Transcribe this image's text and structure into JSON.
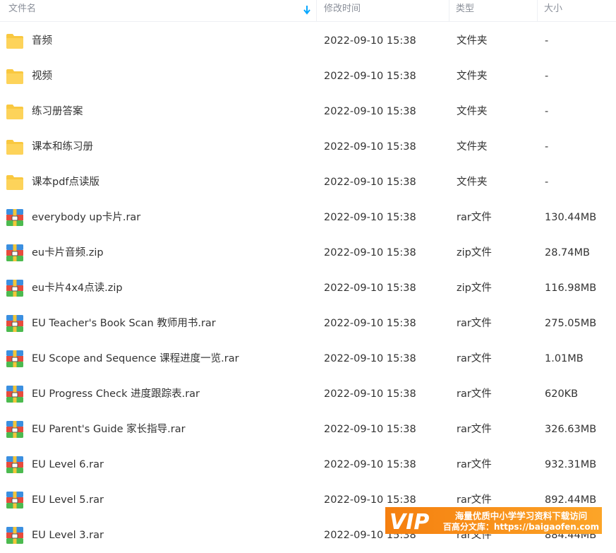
{
  "header": {
    "name_label": "文件名",
    "date_label": "修改时间",
    "type_label": "类型",
    "size_label": "大小"
  },
  "files": [
    {
      "name": "音频",
      "date": "2022-09-10 15:38",
      "type": "文件夹",
      "size": "-",
      "icon": "folder-icon"
    },
    {
      "name": "视频",
      "date": "2022-09-10 15:38",
      "type": "文件夹",
      "size": "-",
      "icon": "folder-icon"
    },
    {
      "name": "练习册答案",
      "date": "2022-09-10 15:38",
      "type": "文件夹",
      "size": "-",
      "icon": "folder-icon"
    },
    {
      "name": "课本和练习册",
      "date": "2022-09-10 15:38",
      "type": "文件夹",
      "size": "-",
      "icon": "folder-icon"
    },
    {
      "name": "课本pdf点读版",
      "date": "2022-09-10 15:38",
      "type": "文件夹",
      "size": "-",
      "icon": "folder-icon"
    },
    {
      "name": "everybody up卡片.rar",
      "date": "2022-09-10 15:38",
      "type": "rar文件",
      "size": "130.44MB",
      "icon": "archive-icon"
    },
    {
      "name": "eu卡片音频.zip",
      "date": "2022-09-10 15:38",
      "type": "zip文件",
      "size": "28.74MB",
      "icon": "archive-icon"
    },
    {
      "name": "eu卡片4x4点读.zip",
      "date": "2022-09-10 15:38",
      "type": "zip文件",
      "size": "116.98MB",
      "icon": "archive-icon"
    },
    {
      "name": "EU Teacher's Book Scan 教师用书.rar",
      "date": "2022-09-10 15:38",
      "type": "rar文件",
      "size": "275.05MB",
      "icon": "archive-icon"
    },
    {
      "name": "EU Scope and Sequence 课程进度一览.rar",
      "date": "2022-09-10 15:38",
      "type": "rar文件",
      "size": "1.01MB",
      "icon": "archive-icon"
    },
    {
      "name": "EU Progress Check 进度跟踪表.rar",
      "date": "2022-09-10 15:38",
      "type": "rar文件",
      "size": "620KB",
      "icon": "archive-icon"
    },
    {
      "name": "EU Parent's Guide 家长指导.rar",
      "date": "2022-09-10 15:38",
      "type": "rar文件",
      "size": "326.63MB",
      "icon": "archive-icon"
    },
    {
      "name": "EU Level 6.rar",
      "date": "2022-09-10 15:38",
      "type": "rar文件",
      "size": "932.31MB",
      "icon": "archive-icon"
    },
    {
      "name": "EU Level 5.rar",
      "date": "2022-09-10 15:38",
      "type": "rar文件",
      "size": "892.44MB",
      "icon": "archive-icon"
    },
    {
      "name": "EU Level 3.rar",
      "date": "2022-09-10 15:38",
      "type": "rar文件",
      "size": "884.44MB",
      "icon": "archive-icon"
    }
  ],
  "watermark": {
    "brand": "VIP",
    "line1": "海量优质中小学学习资料下载访问",
    "line2": "百高分文库：https://baigaofen.com"
  },
  "colors": {
    "folder": "#f9c840",
    "accent": "#06a7ff",
    "watermark": "#f7861a"
  }
}
